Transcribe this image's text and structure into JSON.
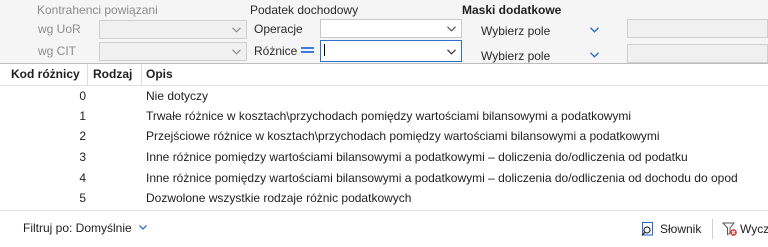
{
  "form": {
    "section_related": "Kontrahenci powiązani",
    "section_tax": "Podatek dochodowy",
    "section_masks": "Maski dodatkowe",
    "row1_label": "wg UoR",
    "row2_label": "wg CIT",
    "tax_row1_label": "Operacje",
    "tax_row2_label": "Różnice",
    "mask_row1_value": "Wybierz pole",
    "mask_row2_value": "Wybierz pole"
  },
  "popup": {
    "columns": {
      "kod": "Kod różnicy",
      "rodzaj": "Rodzaj",
      "opis": "Opis"
    },
    "rows": [
      {
        "kod": "0",
        "rodzaj": "",
        "opis": "Nie dotyczy"
      },
      {
        "kod": "1",
        "rodzaj": "",
        "opis": "Trwałe różnice w kosztach\\przychodach pomiędzy wartościami bilansowymi a podatkowymi"
      },
      {
        "kod": "2",
        "rodzaj": "",
        "opis": "Przejściowe różnice w kosztach\\przychodach pomiędzy wartościami bilansowymi a podatkowymi"
      },
      {
        "kod": "3",
        "rodzaj": "",
        "opis": "Inne różnice pomiędzy wartościami bilansowymi a podatkowymi – doliczenia do/odliczenia od podatku"
      },
      {
        "kod": "4",
        "rodzaj": "",
        "opis": "Inne różnice pomiędzy wartościami bilansowymi a podatkowymi – doliczenia do/odliczenia od dochodu do opod"
      },
      {
        "kod": "5",
        "rodzaj": "",
        "opis": "Dozwolone wszystkie rodzaje różnic podatkowych"
      }
    ],
    "footer": {
      "filter_label": "Filtruj po: Domyślnie",
      "dictionary_label": "Słownik",
      "clear_label": "Wycz"
    }
  },
  "colors": {
    "accent": "#2d6fd1",
    "eq_icon": "#3b7de0",
    "clear_icon_red": "#d9342b"
  }
}
